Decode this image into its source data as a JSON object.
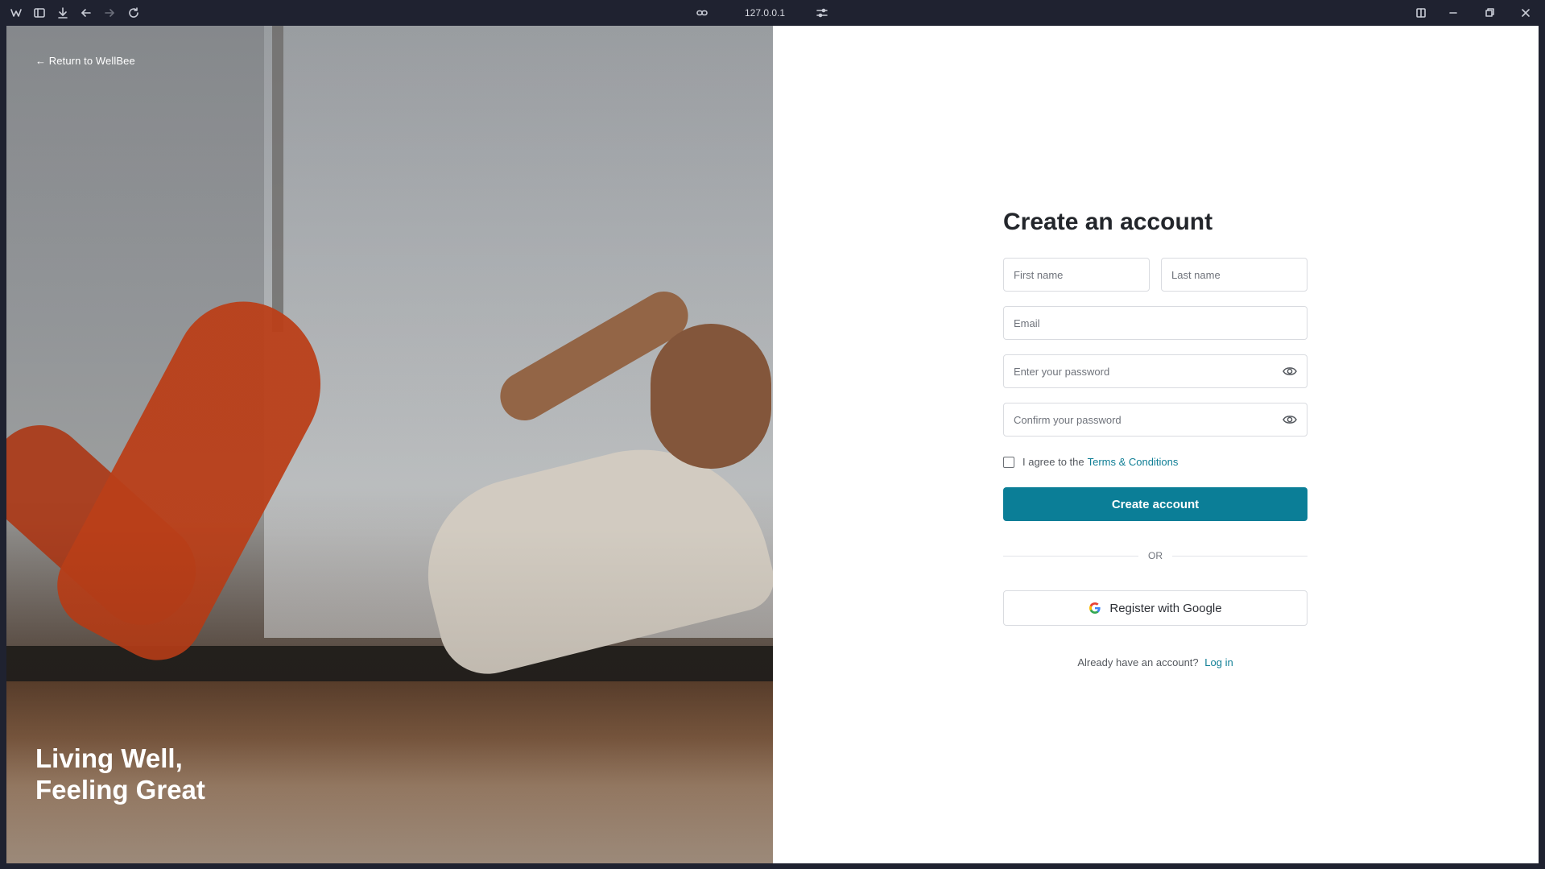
{
  "browser": {
    "url": "127.0.0.1",
    "icons": [
      "browser-logo-icon",
      "sidebar-toggle-icon",
      "download-icon",
      "back-icon",
      "forward-icon",
      "reload-icon",
      "link-icon",
      "site-settings-icon",
      "split-view-icon",
      "minimize-icon",
      "maximize-icon",
      "close-icon"
    ]
  },
  "hero": {
    "return_link": "← Return to WellBee",
    "tagline_line1": "Living Well,",
    "tagline_line2": "Feeling Great"
  },
  "form": {
    "title": "Create an account",
    "first_name_placeholder": "First name",
    "last_name_placeholder": "Last name",
    "email_placeholder": "Email",
    "password_placeholder": "Enter your password",
    "confirm_password_placeholder": "Confirm your password",
    "terms_prefix": "I agree to the",
    "terms_link": "Terms & Conditions",
    "terms_checked": false,
    "submit_label": "Create account",
    "divider_text": "OR",
    "google_label": "Register with Google",
    "login_prompt": "Already have an account?",
    "login_link": "Log in"
  },
  "colors": {
    "accent": "#0b7e97",
    "link": "#0f7e95",
    "chrome_bg": "#1f2230"
  }
}
